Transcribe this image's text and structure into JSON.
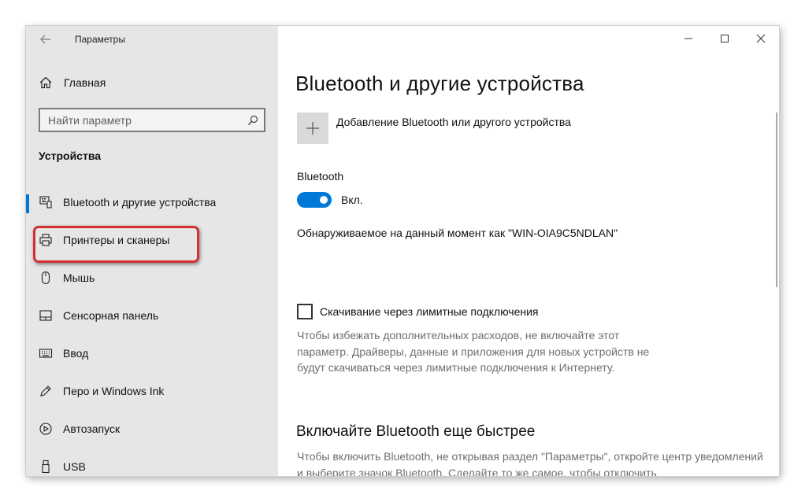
{
  "window": {
    "title": "Параметры",
    "controls": [
      "minimize",
      "maximize",
      "close"
    ]
  },
  "sidebar": {
    "home_label": "Главная",
    "search_placeholder": "Найти параметр",
    "section_title": "Устройства",
    "items": [
      {
        "label": "Bluetooth и другие устройства",
        "icon": "bluetooth-devices-icon",
        "active": true
      },
      {
        "label": "Принтеры и сканеры",
        "icon": "printer-icon",
        "highlighted": true
      },
      {
        "label": "Мышь",
        "icon": "mouse-icon"
      },
      {
        "label": "Сенсорная панель",
        "icon": "touchpad-icon"
      },
      {
        "label": "Ввод",
        "icon": "keyboard-icon"
      },
      {
        "label": "Перо и Windows Ink",
        "icon": "pen-icon"
      },
      {
        "label": "Автозапуск",
        "icon": "autoplay-icon"
      },
      {
        "label": "USB",
        "icon": "usb-icon"
      }
    ]
  },
  "main": {
    "heading": "Bluetooth и другие устройства",
    "add_device_label": "Добавление Bluetooth или другого устройства",
    "bluetooth_label": "Bluetooth",
    "toggle_state": "Вкл.",
    "toggle_on": true,
    "discoverable_text": "Обнаруживаемое на данный момент как \"WIN-OIA9C5NDLAN\"",
    "metered_label": "Скачивание через лимитные подключения",
    "metered_checked": false,
    "metered_desc": "Чтобы избежать дополнительных расходов, не включайте этот параметр. Драйверы, данные и приложения для новых устройств не будут скачиваться через лимитные подключения к Интернету.",
    "faster_heading": "Включайте Bluetooth еще быстрее",
    "faster_desc": "Чтобы включить Bluetooth, не открывая раздел \"Параметры\", откройте центр уведомлений и выберите значок Bluetooth. Сделайте то же самое, чтобы отключить"
  },
  "colors": {
    "accent": "#0078d7",
    "sidebar_bg": "#e6e6e6",
    "highlight": "#d32f2f"
  }
}
